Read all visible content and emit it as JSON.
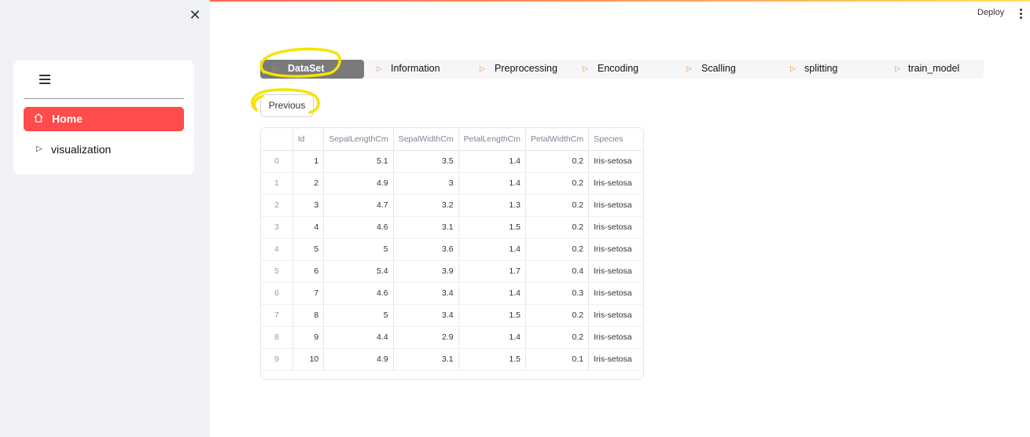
{
  "header": {
    "deploy_label": "Deploy"
  },
  "sidebar": {
    "items": [
      {
        "label": "Home",
        "icon": "home-icon",
        "active": true
      },
      {
        "label": "visualization",
        "icon": "play-triangle-icon",
        "active": false
      }
    ]
  },
  "tabs": [
    {
      "label": "DataSet",
      "active": true
    },
    {
      "label": "Information"
    },
    {
      "label": "Preprocessing"
    },
    {
      "label": "Encoding"
    },
    {
      "label": "Scalling"
    },
    {
      "label": "splitting"
    },
    {
      "label": "train_model"
    }
  ],
  "buttons": {
    "previous_label": "Previous"
  },
  "colors": {
    "accent": "#ff4b4b",
    "tab_active": "#7a7a7a",
    "tab_icon": "#f28c28",
    "highlight": "#f5e400"
  },
  "table": {
    "columns": [
      "",
      "Id",
      "SepalLengthCm",
      "SepalWidthCm",
      "PetalLengthCm",
      "PetalWidthCm",
      "Species"
    ],
    "rows": [
      [
        "0",
        "1",
        "5.1",
        "3.5",
        "1.4",
        "0.2",
        "Iris-setosa"
      ],
      [
        "1",
        "2",
        "4.9",
        "3",
        "1.4",
        "0.2",
        "Iris-setosa"
      ],
      [
        "2",
        "3",
        "4.7",
        "3.2",
        "1.3",
        "0.2",
        "Iris-setosa"
      ],
      [
        "3",
        "4",
        "4.6",
        "3.1",
        "1.5",
        "0.2",
        "Iris-setosa"
      ],
      [
        "4",
        "5",
        "5",
        "3.6",
        "1.4",
        "0.2",
        "Iris-setosa"
      ],
      [
        "5",
        "6",
        "5.4",
        "3.9",
        "1.7",
        "0.4",
        "Iris-setosa"
      ],
      [
        "6",
        "7",
        "4.6",
        "3.4",
        "1.4",
        "0.3",
        "Iris-setosa"
      ],
      [
        "7",
        "8",
        "5",
        "3.4",
        "1.5",
        "0.2",
        "Iris-setosa"
      ],
      [
        "8",
        "9",
        "4.4",
        "2.9",
        "1.4",
        "0.2",
        "Iris-setosa"
      ],
      [
        "9",
        "10",
        "4.9",
        "3.1",
        "1.5",
        "0.1",
        "Iris-setosa"
      ]
    ]
  }
}
